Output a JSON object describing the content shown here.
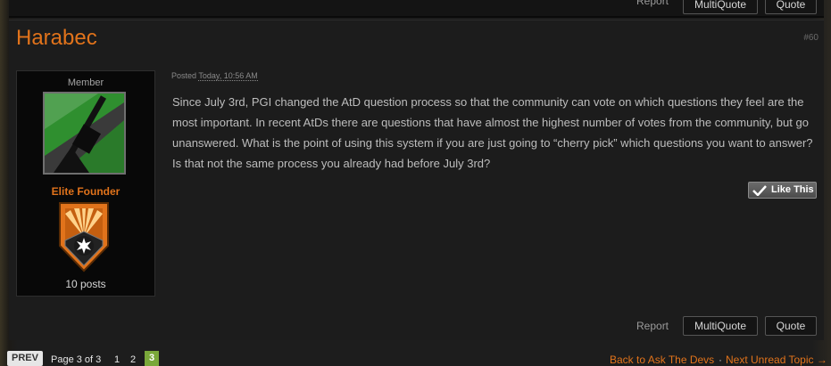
{
  "top_bar": {
    "report_label": "Report",
    "multiquote_label": "MultiQuote",
    "quote_label": "Quote"
  },
  "post": {
    "author": "Harabec",
    "number": "#60",
    "member_title": "Member",
    "group": "Elite Founder",
    "post_count": "10 posts",
    "posted_label": "Posted",
    "posted_date": "Today, 10:56 AM",
    "body": "Since July 3rd, PGI changed the AtD question process so that the community can vote on which questions they feel are the most important. In recent AtDs there are questions that have almost the highest number of votes from the community, but go unanswered. What is the point of using this system if you are just going to “cherry pick” which questions you want to answer? Is that not the same process you already had before July 3rd?",
    "like_label": "Like This",
    "report_label": "Report",
    "multiquote_label": "MultiQuote",
    "quote_label": "Quote"
  },
  "pagination": {
    "prev_label": "PREV",
    "page_info": "Page 3 of 3",
    "pages": [
      "1",
      "2",
      "3"
    ],
    "current_page": "3"
  },
  "footer_links": {
    "back_label": "Back to Ask The Devs",
    "separator": "·",
    "next_label": "Next Unread Topic →"
  },
  "colors": {
    "accent": "#e1731b",
    "active_page": "#7aa83a",
    "avatar_green": "#2f8f2f"
  }
}
